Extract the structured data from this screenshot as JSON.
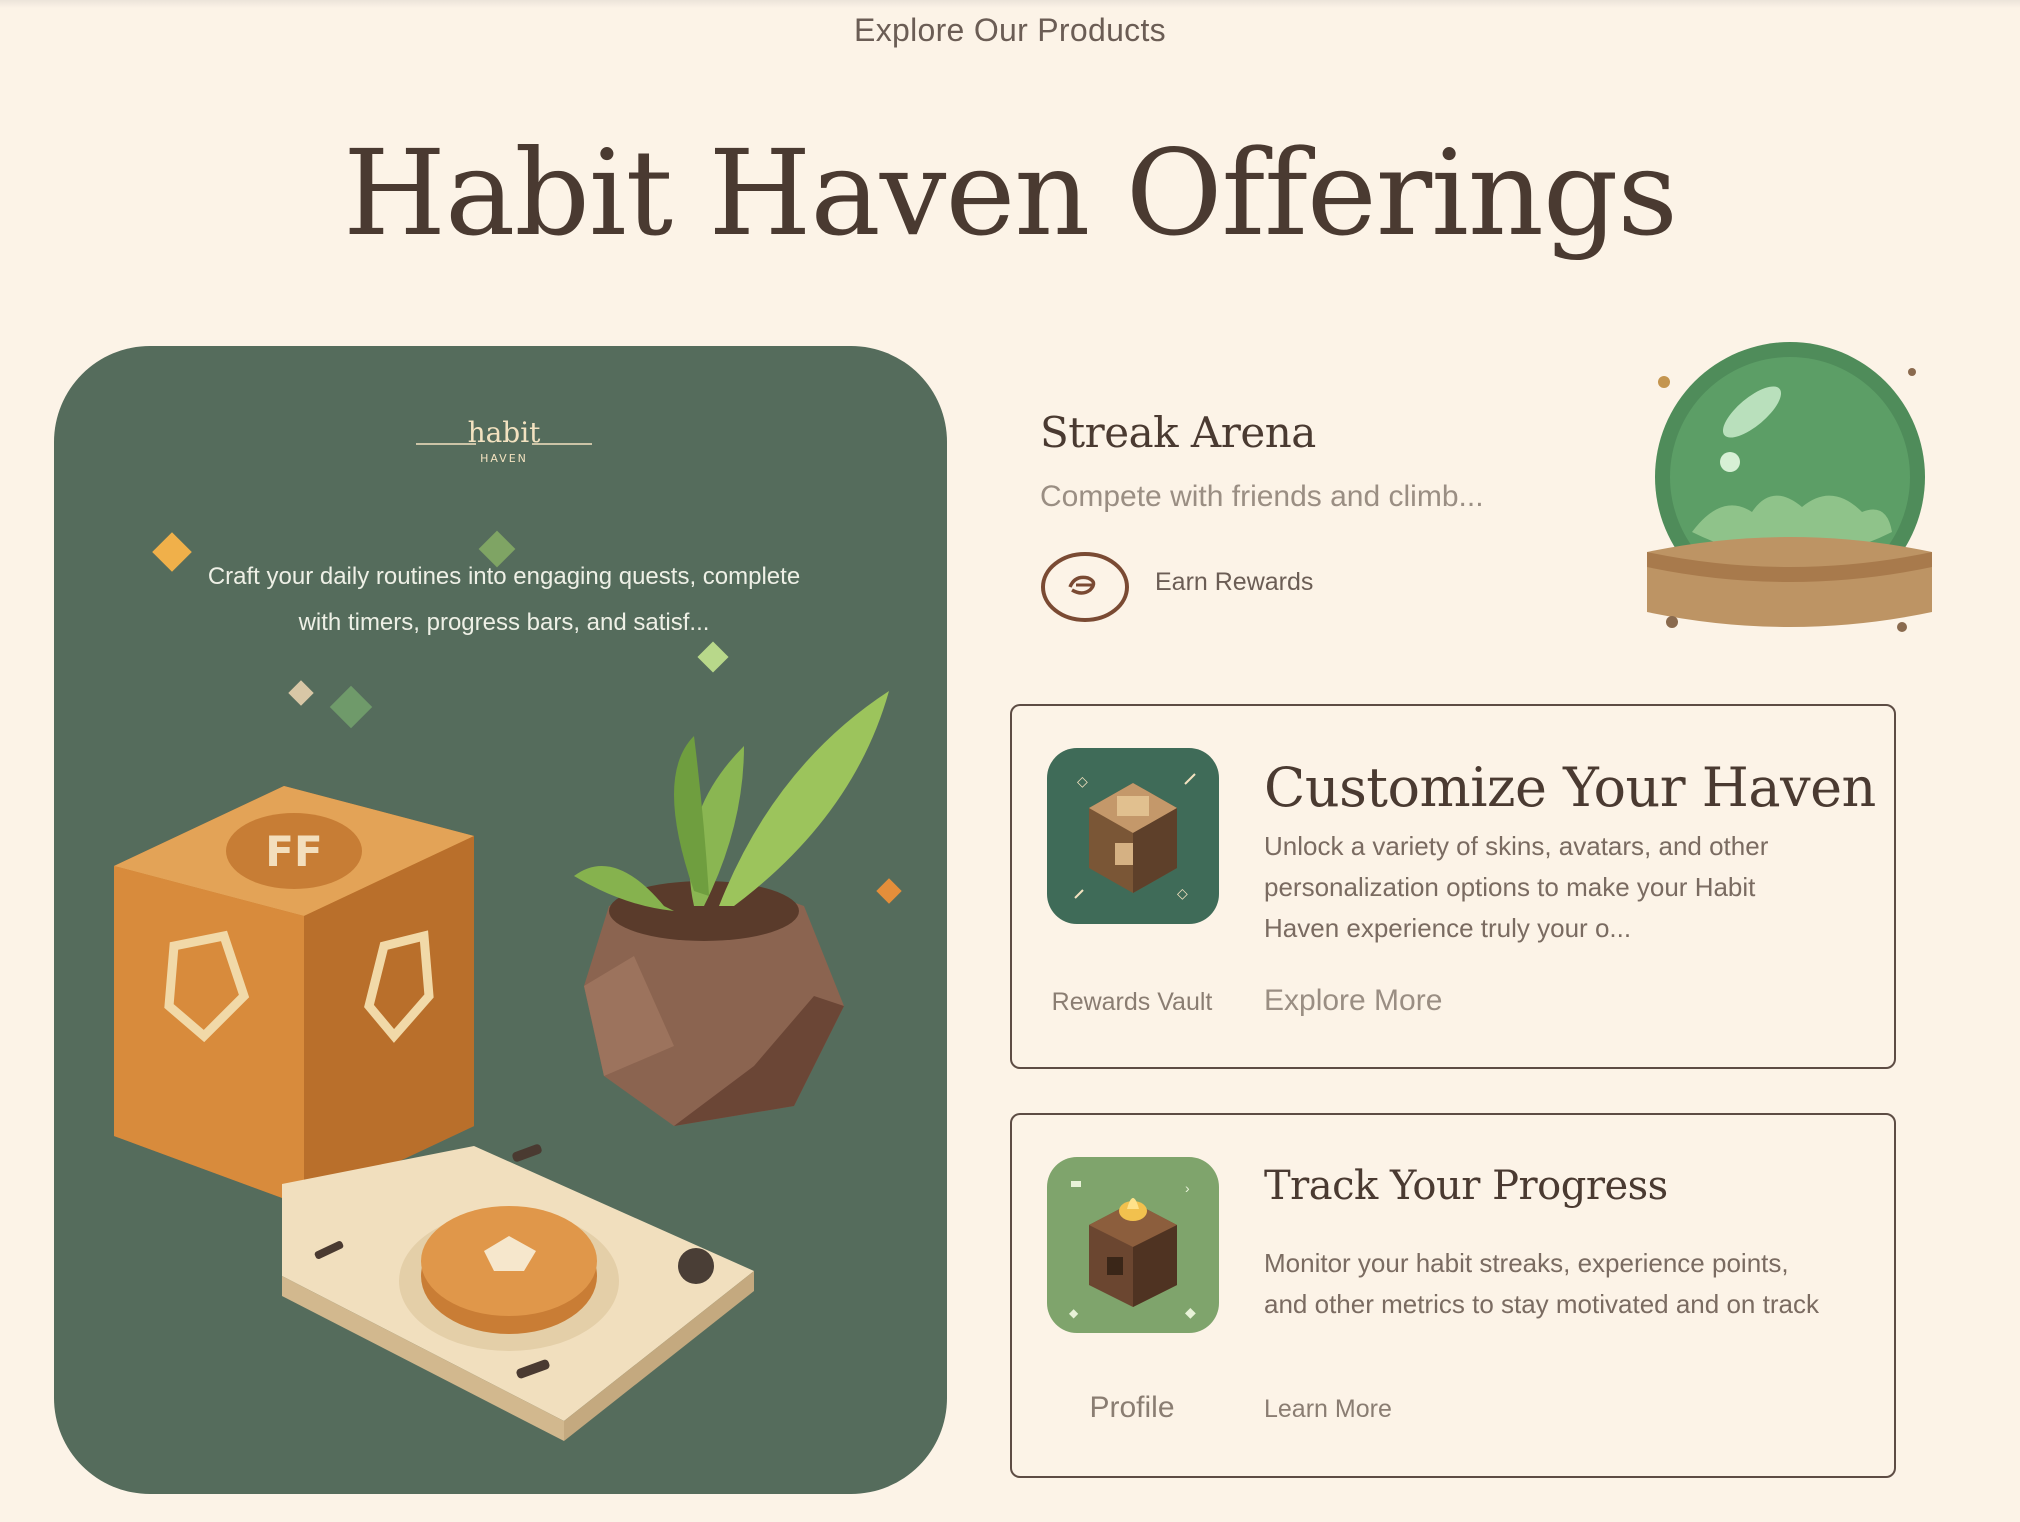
{
  "header": {
    "eyebrow": "Explore Our Products",
    "title": "Habit Haven Offerings"
  },
  "hero": {
    "logo_text": "habit",
    "logo_subtext": "HAVEN",
    "description": "Craft your daily routines into engaging quests, complete with timers, progress bars, and satisf..."
  },
  "streak": {
    "title": "Streak Arena",
    "description": "Compete with friends and climb...",
    "rewards_label": "Earn Rewards"
  },
  "cards": [
    {
      "title": "Customize Your Haven",
      "description": "Unlock a variety of skins, avatars, and other personalization options to make your Habit Haven experience truly your o...",
      "sublabel": "Rewards Vault",
      "link": "Explore More"
    },
    {
      "title": "Track Your Progress",
      "description": "Monitor your habit streaks, experience points, and other metrics to stay motivated and on track",
      "sublabel": "Profile",
      "link": "Learn More"
    }
  ],
  "colors": {
    "background": "#fcf3e7",
    "hero_green": "#556c5c",
    "text_dark": "#4a3a31",
    "accent_orange": "#d9913e"
  }
}
